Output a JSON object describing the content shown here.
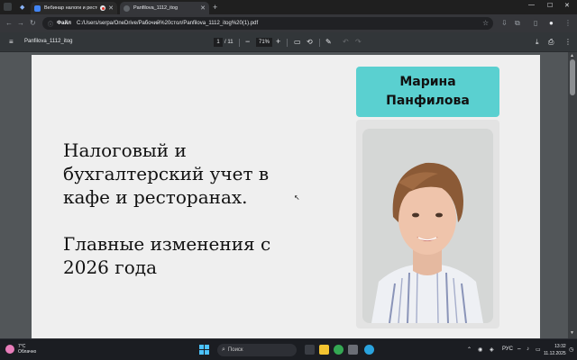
{
  "browser": {
    "tabs": [
      {
        "title": "Вебинар налоги и рестор",
        "favicon_color": "#4285f4"
      },
      {
        "title": "Panfilova_1112_itog",
        "favicon_color": "#d93025"
      }
    ],
    "new_tab": "+",
    "close": "✕",
    "address": {
      "scheme_label": "Файл",
      "url": "C:/Users/serpa/OneDrive/Рабочий%20стол/Panfilova_1112_itog%20(1).pdf"
    }
  },
  "pdf_toolbar": {
    "title": "Panfilova_1112_itog",
    "page_current": "1",
    "page_total": "/ 11",
    "zoom": "71%",
    "zoom_minus": "−",
    "zoom_plus": "+"
  },
  "slide": {
    "heading_lines": [
      "Налоговый и",
      "бухгалтерский учет в",
      "кафе и ресторанах."
    ],
    "subheading_lines": [
      "Главные изменения с",
      "2026 года"
    ],
    "name_lines": [
      "Марина",
      "Панфилова"
    ],
    "accent_color": "#5ad0d0"
  },
  "taskbar": {
    "weather_temp": "7°C",
    "weather_desc": "Облачно",
    "search_placeholder": "Поиск",
    "language": "РУС",
    "time": "13:32",
    "date": "11.12.2025"
  }
}
